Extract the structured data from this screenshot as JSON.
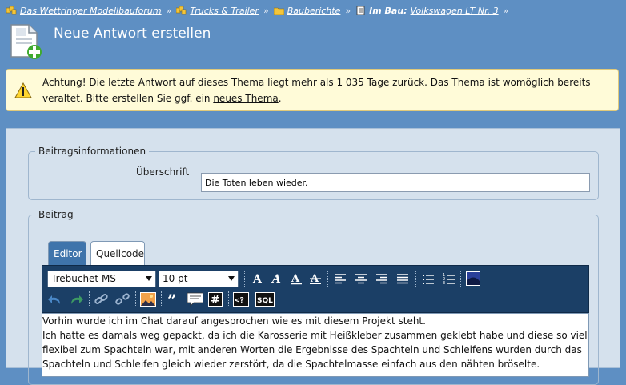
{
  "breadcrumb": {
    "items": [
      "Das Wettringer Modellbauforum",
      "Trucks & Trailer",
      "Bauberichte"
    ],
    "current_prefix": "Im Bau:",
    "current_link": "Volkswagen LT Nr. 3",
    "separator": "»"
  },
  "header": {
    "title": "Neue Antwort erstellen"
  },
  "warning": {
    "line1": "Achtung! Die letzte Antwort auf dieses Thema liegt mehr als 1 035 Tage zurück. Das Thema ist womöglich bereits",
    "line2_before": "veraltet. Bitte erstellen Sie ggf. ein ",
    "line2_link": "neues Thema",
    "line2_after": "."
  },
  "post_info": {
    "legend": "Beitragsinformationen",
    "subject_label": "Überschrift",
    "subject_value": "Die Toten leben wieder."
  },
  "post": {
    "legend": "Beitrag",
    "tabs": [
      "Editor",
      "Quellcode"
    ],
    "font_select": "Trebuchet MS",
    "size_select": "10 pt",
    "body_lines": [
      "Vorhin wurde ich im Chat darauf angesprochen wie es mit diesem Projekt steht.",
      "Ich hatte es damals weg gepackt, da ich die Karosserie mit Heißkleber zusammen geklebt habe und diese so viel zu",
      "flexibel zum Spachteln war, mit anderen Worten die Ergebnisse des Spachteln und Schleifens wurden durch das",
      "Spachteln und Schleifen gleich wieder zerstört, da die Spachtelmasse einfach aus den nähten bröselte."
    ]
  },
  "colors": {
    "background": "#5e8fc3",
    "warning_bg": "#fffbd8",
    "toolbar": "#1b3f66",
    "tab_active": "#3f74ab"
  }
}
